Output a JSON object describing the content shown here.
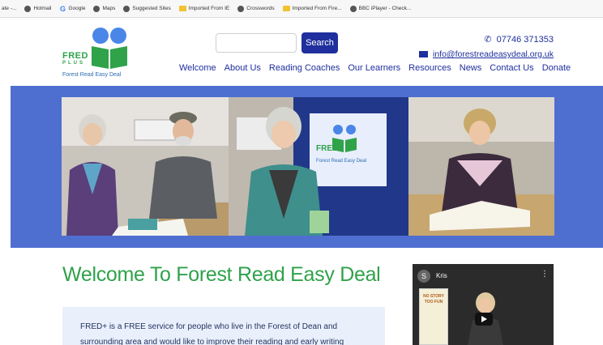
{
  "bookmarks": [
    {
      "label": "ate -...",
      "icon": "partial"
    },
    {
      "label": "Hotmail",
      "icon": "globe-icon"
    },
    {
      "label": "Google",
      "icon": "google-icon"
    },
    {
      "label": "Maps",
      "icon": "globe-icon"
    },
    {
      "label": "Suggested Sites",
      "icon": "globe-icon"
    },
    {
      "label": "Imported From IE",
      "icon": "folder-icon"
    },
    {
      "label": "Crosswords",
      "icon": "globe-icon"
    },
    {
      "label": "Imported From Fire...",
      "icon": "folder-icon"
    },
    {
      "label": "BBC iPlayer - Check...",
      "icon": "globe-icon"
    }
  ],
  "logo": {
    "fred": "FRED",
    "plus": "PLUS",
    "subtitle": "Forest Read Easy Deal"
  },
  "search": {
    "placeholder": "",
    "button_label": "Search"
  },
  "contact": {
    "phone": "07746 371353",
    "email": "info@forestreadeasydeal.org.uk"
  },
  "nav": [
    "Welcome",
    "About Us",
    "Reading Coaches",
    "Our Learners",
    "Resources",
    "News",
    "Contact Us",
    "Donate"
  ],
  "banner_photo_poster": {
    "fred": "FRED",
    "subtitle": "Forest Read Easy Deal"
  },
  "main": {
    "title": "Welcome To Forest Read Easy Deal",
    "intro_line1": "FRED+ is a FREE service for people who live in the Forest of Dean and",
    "intro_line2": "surrounding area and would like to improve their reading and early writing"
  },
  "video": {
    "avatar_letter": "S",
    "title": "Kris",
    "book_text": "NO STORY TOO FUN"
  },
  "colors": {
    "brand_green": "#2fa24a",
    "brand_blue": "#1f2f9d",
    "banner_blue": "#4f6fd0"
  }
}
